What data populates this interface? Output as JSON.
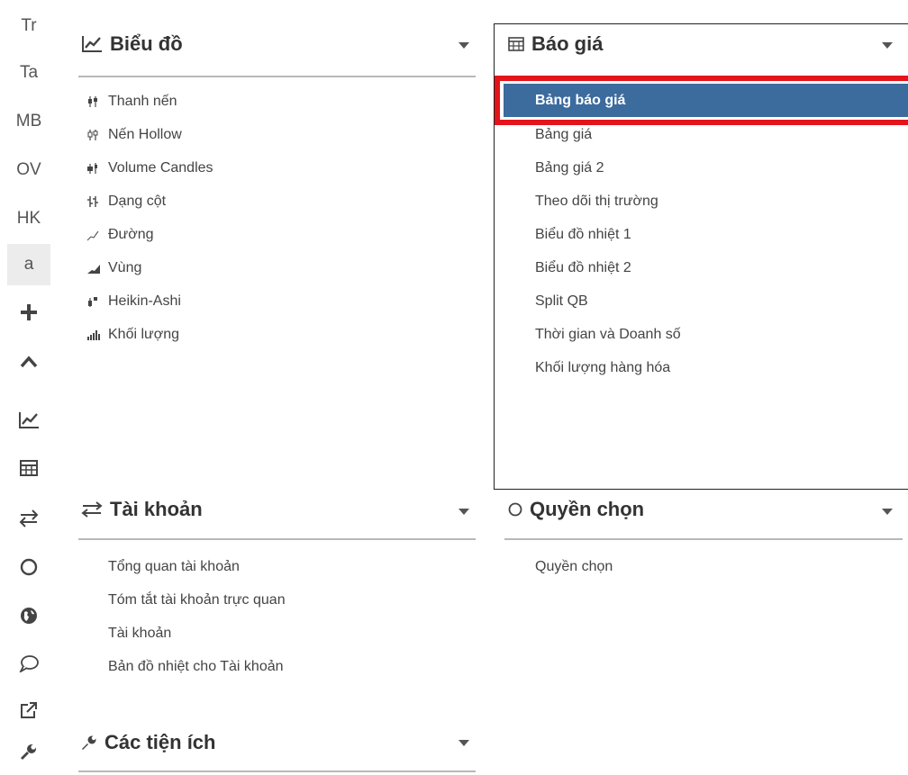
{
  "toolbar": {
    "items": [
      "Tr",
      "Ta",
      "MB",
      "OV",
      "HK",
      "a"
    ],
    "icons": [
      "plus-icon",
      "chevron-up-icon",
      "chart-line-icon",
      "table-icon",
      "transfer-icon",
      "circle-icon",
      "globe-icon",
      "chat-icon",
      "external-link-icon",
      "wrench-icon"
    ]
  },
  "chart_panel": {
    "title": "Biểu đồ",
    "items": [
      "Thanh nến",
      "Nến Hollow",
      "Volume Candles",
      "Dạng cột",
      "Đường",
      "Vùng",
      "Heikin-Ashi",
      "Khối lượng"
    ]
  },
  "quote_panel": {
    "title": "Báo giá",
    "selected": "Bảng báo giá",
    "items": [
      "Bảng giá",
      "Bảng giá 2",
      "Theo dõi thị trường",
      "Biểu đồ nhiệt 1",
      "Biểu đồ nhiệt 2",
      "Split QB",
      "Thời gian và Doanh số",
      "Khối lượng hàng hóa"
    ]
  },
  "account_panel": {
    "title": "Tài khoản",
    "items": [
      "Tổng quan tài khoản",
      "Tóm tắt tài khoản trực quan",
      "Tài khoản",
      "Bản đồ nhiệt cho Tài khoản"
    ]
  },
  "options_panel": {
    "title": "Quyền chọn",
    "items": [
      "Quyền chọn"
    ]
  },
  "utilities_panel": {
    "title": "Các tiện ích"
  },
  "colors": {
    "selected_bg": "#3c6b9e",
    "highlight": "#e4141b"
  }
}
